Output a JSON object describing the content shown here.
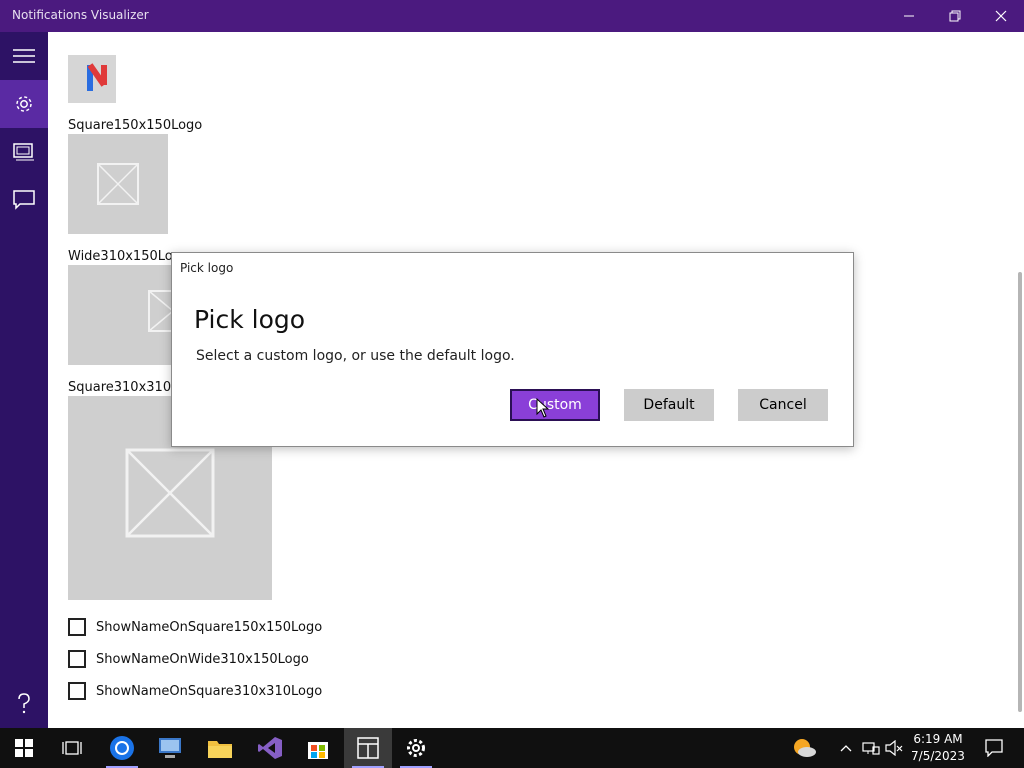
{
  "window": {
    "title": "Notifications Visualizer",
    "controls": [
      "minimize",
      "restore",
      "close"
    ]
  },
  "nav": {
    "items": [
      {
        "icon": "hamburger-icon"
      },
      {
        "icon": "gear-icon",
        "active": true
      },
      {
        "icon": "tiles-icon"
      },
      {
        "icon": "chat-icon"
      },
      {
        "icon": "help-icon"
      }
    ]
  },
  "content": {
    "logos": [
      {
        "label": "Square150x150Logo"
      },
      {
        "label": "Wide310x150Logo"
      },
      {
        "label": "Square310x310Logo"
      }
    ],
    "checkboxes": [
      {
        "label": "ShowNameOnSquare150x150Logo",
        "checked": false
      },
      {
        "label": "ShowNameOnWide310x150Logo",
        "checked": false
      },
      {
        "label": "ShowNameOnSquare310x310Logo",
        "checked": false
      }
    ]
  },
  "dialog": {
    "window_title": "Pick logo",
    "heading": "Pick logo",
    "message": "Select a custom logo, or use the default logo.",
    "buttons": {
      "custom": "Custom",
      "default": "Default",
      "cancel": "Cancel"
    }
  },
  "taskbar": {
    "time": "6:19 AM",
    "date": "7/5/2023"
  },
  "colors": {
    "titlebar": "#4b1a7f",
    "nav": "#2d1265",
    "nav_active": "#5a2aa3",
    "accent": "#8a3fd8"
  }
}
